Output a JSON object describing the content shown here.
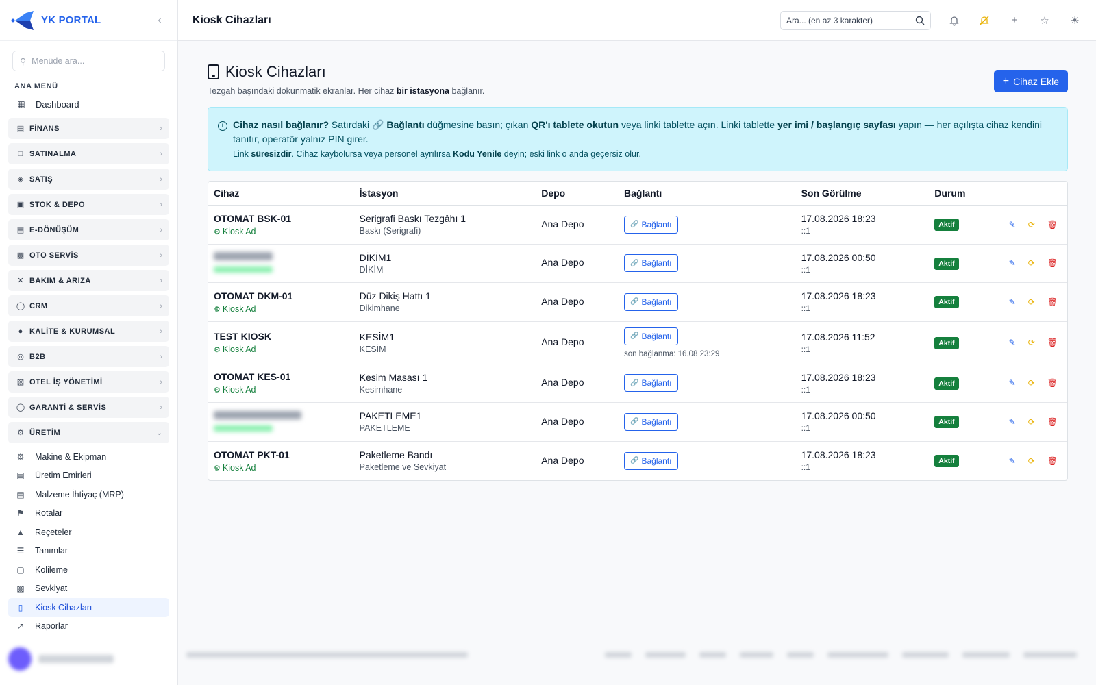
{
  "brand": {
    "name": "YK PORTAL"
  },
  "sidebar": {
    "search_placeholder": "Menüde ara...",
    "section_title": "ANA MENÜ",
    "dashboard": "Dashboard",
    "groups": [
      {
        "label": "FİNANS",
        "icon": "bank-icon"
      },
      {
        "label": "SATINALMA",
        "icon": "cart-icon"
      },
      {
        "label": "SATIŞ",
        "icon": "tag-icon"
      },
      {
        "label": "STOK & DEPO",
        "icon": "box-icon"
      },
      {
        "label": "E-DÖNÜŞÜM",
        "icon": "document-icon"
      },
      {
        "label": "OTO SERVİS",
        "icon": "car-icon"
      },
      {
        "label": "BAKIM & ARIZA",
        "icon": "tools-icon"
      },
      {
        "label": "CRM",
        "icon": "headset-icon"
      },
      {
        "label": "KALİTE & KURUMSAL",
        "icon": "seal-icon"
      },
      {
        "label": "B2B",
        "icon": "globe-icon"
      },
      {
        "label": "OTEL İŞ YÖNETİMİ",
        "icon": "building-icon"
      },
      {
        "label": "GARANTİ & SERVİS",
        "icon": "shield-icon"
      }
    ],
    "production": {
      "label": "ÜRETİM",
      "items": [
        "Makine & Ekipman",
        "Üretim Emirleri",
        "Malzeme İhtiyaç (MRP)",
        "Rotalar",
        "Reçeteler",
        "Tanımlar",
        "Kolileme",
        "Sevkiyat",
        "Kiosk Cihazları",
        "Raporlar"
      ]
    }
  },
  "topbar": {
    "title": "Kiosk Cihazları",
    "search_placeholder": "Ara... (en az 3 karakter)"
  },
  "page": {
    "title": "Kiosk Cihazları",
    "subtitle_pre": "Tezgah başındaki dokunmatik ekranlar. Her cihaz ",
    "subtitle_bold": "bir istasyona",
    "subtitle_post": " bağlanır.",
    "add_button": "Cihaz Ekle"
  },
  "info": {
    "q": "Cihaz nasıl bağlanır?",
    "t1": " Satırdaki ",
    "b1": "Bağlantı",
    "t2": " düğmesine basın; çıkan ",
    "b2": "QR'ı tablete okutun",
    "t3": " veya linki tablette açın. Linki tablette ",
    "b3": "yer imi / başlangıç sayfası",
    "t4": " yapın — her açılışta cihaz kendini tanıtır, operatör yalnız PIN girer.",
    "s1": "Link ",
    "sb1": "süresizdir",
    "s2": ". Cihaz kaybolursa veya personel ayrılırsa ",
    "sb2": "Kodu Yenile",
    "s3": " deyin; eski link o anda geçersiz olur."
  },
  "table": {
    "headers": [
      "Cihaz",
      "İstasyon",
      "Depo",
      "Bağlantı",
      "Son Görülme",
      "Durum"
    ],
    "link_label": "Bağlantı",
    "rows": [
      {
        "device": "OTOMAT BSK-01",
        "device_sub": "Kiosk Ad",
        "station": "Serigrafi Baskı Tezgâhı 1",
        "station_sub": "Baskı (Serigrafi)",
        "depo": "Ana Depo",
        "last_conn": "",
        "seen": "17.08.2026 18:23",
        "seen_sub": "::1",
        "status": "Aktif",
        "blurred": false
      },
      {
        "device": "",
        "device_sub": "",
        "station": "DİKİM1",
        "station_sub": "DİKİM",
        "depo": "Ana Depo",
        "last_conn": "",
        "seen": "17.08.2026 00:50",
        "seen_sub": "::1",
        "status": "Aktif",
        "blurred": true
      },
      {
        "device": "OTOMAT DKM-01",
        "device_sub": "Kiosk Ad",
        "station": "Düz Dikiş Hattı 1",
        "station_sub": "Dikimhane",
        "depo": "Ana Depo",
        "last_conn": "",
        "seen": "17.08.2026 18:23",
        "seen_sub": "::1",
        "status": "Aktif",
        "blurred": false
      },
      {
        "device": "TEST KIOSK",
        "device_sub": "Kiosk Ad",
        "station": "KESİM1",
        "station_sub": "KESİM",
        "depo": "Ana Depo",
        "last_conn": "son bağlanma: 16.08 23:29",
        "seen": "17.08.2026 11:52",
        "seen_sub": "::1",
        "status": "Aktif",
        "blurred": false
      },
      {
        "device": "OTOMAT KES-01",
        "device_sub": "Kiosk Ad",
        "station": "Kesim Masası 1",
        "station_sub": "Kesimhane",
        "depo": "Ana Depo",
        "last_conn": "",
        "seen": "17.08.2026 18:23",
        "seen_sub": "::1",
        "status": "Aktif",
        "blurred": false
      },
      {
        "device": "",
        "device_sub": "",
        "station": "PAKETLEME1",
        "station_sub": "PAKETLEME",
        "depo": "Ana Depo",
        "last_conn": "",
        "seen": "17.08.2026 00:50",
        "seen_sub": "::1",
        "status": "Aktif",
        "blurred": true
      },
      {
        "device": "OTOMAT PKT-01",
        "device_sub": "Kiosk Ad",
        "station": "Paketleme Bandı",
        "station_sub": "Paketleme ve Sevkiyat",
        "depo": "Ana Depo",
        "last_conn": "",
        "seen": "17.08.2026 18:23",
        "seen_sub": "::1",
        "status": "Aktif",
        "blurred": false
      }
    ]
  },
  "colors": {
    "primary": "#2563eb",
    "success": "#15803d",
    "info_bg": "#cff4fc",
    "warning": "#eab308",
    "danger": "#dc2626"
  }
}
